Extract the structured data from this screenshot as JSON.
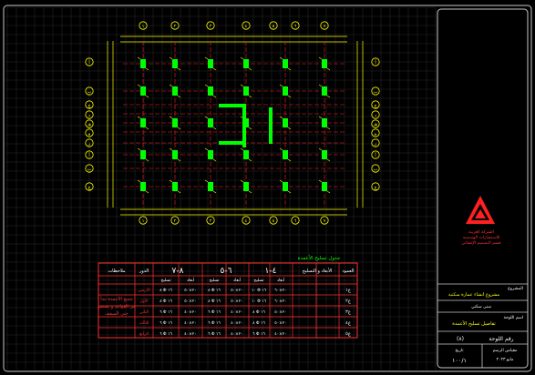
{
  "drawing": {
    "background": "#000000",
    "grid_color": "#2a2a2a",
    "axis_color": "#ff2020",
    "column_color": "#00ff00",
    "dimension_color": "#ffff00",
    "axis_labels_top": [
      "١",
      "٢",
      "٣",
      "٤",
      "٥",
      "٦",
      "٧"
    ],
    "axis_labels_bottom": [
      "١",
      "٢",
      "٣",
      "٤",
      "٥",
      "٦",
      "٧"
    ],
    "axis_labels_left": [
      "أ",
      "ب",
      "ج",
      "د",
      "هـ",
      "و",
      "ز"
    ],
    "axis_labels_right": [
      "أ",
      "ب",
      "ج",
      "د",
      "هـ",
      "و",
      "ز"
    ]
  },
  "schedule": {
    "title": "جدول تسليح الأعمدة",
    "header_row": {
      "notes": "ملاحظات",
      "floor": "الدور",
      "group_a": "٨-٧",
      "group_b": "٦-٥",
      "group_c": "٤-١",
      "dims_col": "الأبعاد و التسليح",
      "col_label": "العمود"
    },
    "subheaders": [
      "تسليح",
      "أبعاد",
      "تسليح",
      "أبعاد",
      "تسليح",
      "أبعاد"
    ],
    "notes_text": "جميع الأعمدة تبدأ من القواعد و تستمر حتى السقف",
    "rows": [
      {
        "floor": "الأرضي",
        "a1": "٨ Φ ١٦",
        "a2": "٢٠×٥٠",
        "b1": "٨ Φ ١٦",
        "b2": "٢٠×٥٠",
        "c1": "١٠ Φ ١٦",
        "c2": "٢٠×٦٠",
        "col": "ع١"
      },
      {
        "floor": "الأول",
        "a1": "٨ Φ ١٦",
        "a2": "٢٠×٥٠",
        "b1": "٨ Φ ١٦",
        "b2": "٢٠×٥٠",
        "c1": "١٠ Φ ١٦",
        "c2": "٢٠×٦٠",
        "col": "ع٢"
      },
      {
        "floor": "الثاني",
        "a1": "٦ Φ ١٦",
        "a2": "٢٠×٤٠",
        "b1": "٦ Φ ١٦",
        "b2": "٢٠×٤٠",
        "c1": "٨ Φ ١٦",
        "c2": "٢٠×٥٠",
        "col": "ع٣"
      },
      {
        "floor": "الثالث",
        "a1": "٦ Φ ١٦",
        "a2": "٢٠×٤٠",
        "b1": "٦ Φ ١٦",
        "b2": "٢٠×٤٠",
        "c1": "٨ Φ ١٦",
        "c2": "٢٠×٥٠",
        "col": "ع٤"
      },
      {
        "floor": "الرابع",
        "a1": "٦ Φ ١٦",
        "a2": "٢٠×٤٠",
        "b1": "٦ Φ ١٦",
        "b2": "٢٠×٤٠",
        "c1": "٦ Φ ١٦",
        "c2": "٢٠×٤٠",
        "col": "ع٥"
      }
    ]
  },
  "title_block": {
    "org_line1": "الشركة العربية",
    "org_line2": "للاستشارات الهندسية",
    "org_line3": "قسم التصميم الإنشائي",
    "project_label": "المشروع",
    "project_name": "مشروع انشاء عمارة سكنية",
    "drawing_label": "اسم اللوحة",
    "drawing_name": "تفاصيل تسليح الأعمدة",
    "owner_label": "المالك",
    "owner_name": "مبنى سكني",
    "sheet_label": "رقم اللوحة",
    "sheet_number": "(٨)",
    "scale_label": "مقياس الرسم",
    "scale_value": "١٠٠/١",
    "date_label": "تاريخ",
    "date_value": "مايو ٢٠٢٣"
  }
}
